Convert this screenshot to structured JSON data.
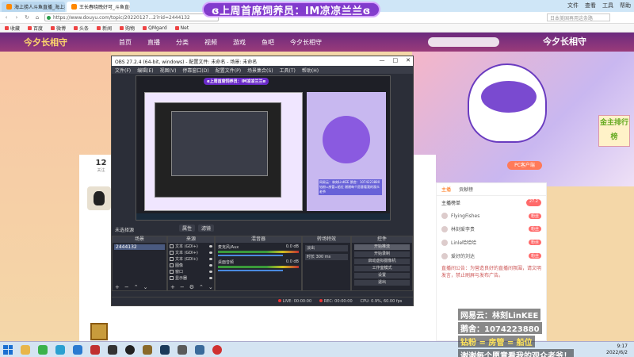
{
  "stream_title": "ɞ上周首席饲养员：IM凉凉兰兰ɞ",
  "browser": {
    "tabs": [
      {
        "label": "海上捞人斗鱼直播_海上捞人...",
        "active": false
      },
      {
        "label": "王长春晓晚好可_斗鱼直播_...",
        "active": true
      }
    ],
    "window_controls": [
      "文件",
      "查看",
      "工具",
      "帮助"
    ],
    "url": "https://www.douyu.com/topic/20220127...2?rid=2444132",
    "search_placeholder": "日本美国再用这条路",
    "bookmarks": [
      "收藏",
      "百度",
      "微博",
      "头条",
      "新闻",
      "购物",
      "QMgard",
      "Net"
    ]
  },
  "site": {
    "logo": "今夕长相守",
    "nav": [
      "首页",
      "直播",
      "分类",
      "视频",
      "游戏",
      "鱼吧",
      "今夕长相守"
    ],
    "right_logo": "今夕长相守",
    "info_num": "12",
    "info_sub": "关注",
    "pc_button": "PC客户端",
    "corner_badge": "金主排行榜"
  },
  "chat": {
    "tabs": [
      "主播",
      "贡献榜"
    ],
    "head": "主播榜单",
    "head_pill": "27.2",
    "users": [
      {
        "name": "FlyingFishes",
        "lvl": "粉丝"
      },
      {
        "name": "林刻爱李贵",
        "lvl": "粉丝"
      },
      {
        "name": "Linle哈哈哈",
        "lvl": "粉丝"
      },
      {
        "name": "爱好的刘达",
        "lvl": "粉丝"
      }
    ],
    "message": "直播间公告：为营造良好的直播间氛围，请文明发言，禁止刷屏与发布广告。"
  },
  "contact": {
    "line1": "网易云：林刻LinKEE",
    "line2": "鹅舍：1074223880",
    "line3": "钻粉 = 房管 = 船位",
    "line4": "谢谢每个愿意看我的观众老爷！"
  },
  "obs": {
    "title": "OBS 27.2.4 (64-bit, windows) - 配置文件: 未命名 - 场景: 未命名",
    "window_ctrls": [
      "—",
      "□",
      "✕"
    ],
    "menu": [
      "文件(F)",
      "编辑(E)",
      "视图(V)",
      "停靠窗口(D)",
      "配置文件(P)",
      "场景集合(S)",
      "工具(T)",
      "帮助(H)"
    ],
    "nest_banner": "ɞ上周首席饲养员：IM凉凉兰兰ɞ",
    "nest_contact": "网易云：林刻LinKEE 鹅舍：1074223880 钻粉=房管=船位 谢谢每个愿意看我的观众老爷",
    "dock_label": "未选择源",
    "dock_tabs": [
      "属性",
      "滤镜"
    ],
    "panels": {
      "scenes": "场景",
      "sources": "来源",
      "mixer": "混音器",
      "transitions": "转场特效",
      "controls": "控件"
    },
    "scene_item": "2444132",
    "sources": [
      "文本 (GDI+)",
      "文本 (GDI+)",
      "文本 (GDI+)",
      "图像",
      "窗口",
      "显示器"
    ],
    "mixer": [
      {
        "name": "麦克风/Aux",
        "db": "0.0 dB"
      },
      {
        "name": "桌面音频",
        "db": "0.0 dB"
      }
    ],
    "transition": "淡出",
    "duration_label": "时长",
    "duration": "300 ms",
    "controls": [
      "开始推流",
      "开始录制",
      "启动虚拟摄像机",
      "工作室模式",
      "设置",
      "退出"
    ],
    "status": {
      "live": "LIVE: 00:00:00",
      "rec": "REC: 00:00:00",
      "cpu": "CPU: 0.9%, 60.00 fps"
    }
  },
  "taskbar": {
    "time": "9:17",
    "date": "2022/6/2"
  },
  "colors": {
    "obs_bg": "#2b2e38",
    "title_purple": "#7828c8",
    "site_nav": "#6b2a7e"
  }
}
